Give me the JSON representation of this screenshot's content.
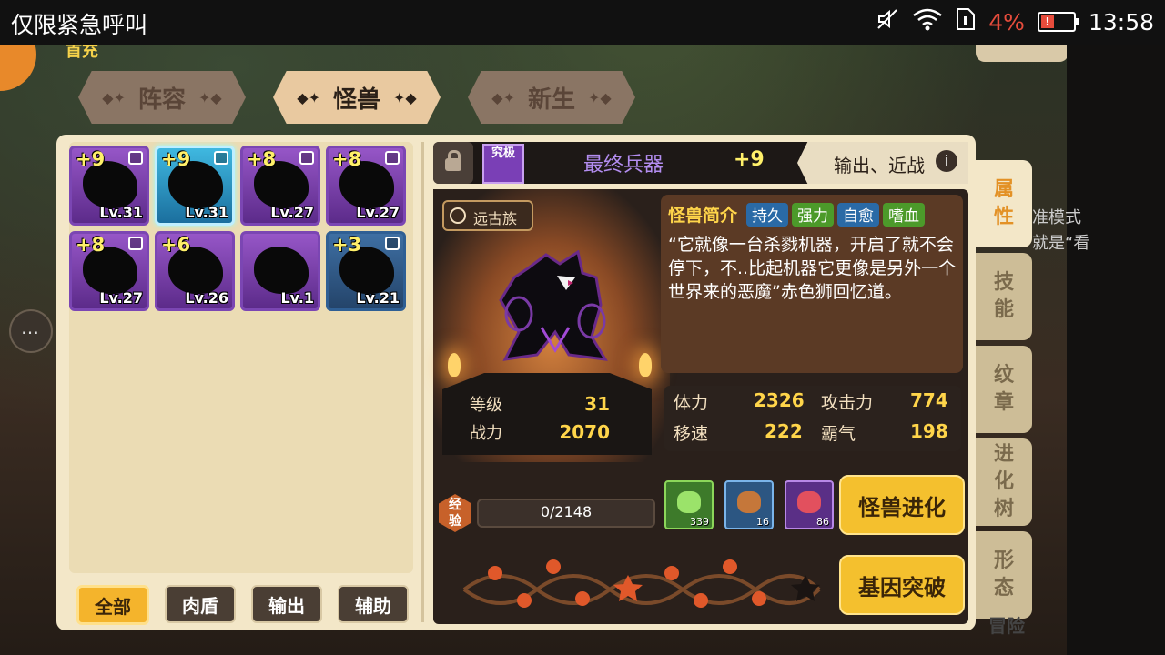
{
  "status_bar": {
    "title": "仅限紧急呼叫",
    "battery_percent": "4%",
    "battery_alert": "!",
    "time": "13:58"
  },
  "corner_tag": "首充",
  "tabs": [
    {
      "label": "阵容",
      "active": false
    },
    {
      "label": "怪兽",
      "active": true
    },
    {
      "label": "新生",
      "active": false
    }
  ],
  "monster_cards": [
    {
      "plus": "+9",
      "level": "Lv.31",
      "frame": "purple",
      "locked": true,
      "selected": false
    },
    {
      "plus": "+9",
      "level": "Lv.31",
      "frame": "blue-selected",
      "locked": true,
      "selected": true
    },
    {
      "plus": "+8",
      "level": "Lv.27",
      "frame": "purple",
      "locked": true,
      "selected": false
    },
    {
      "plus": "+8",
      "level": "Lv.27",
      "frame": "purple",
      "locked": true,
      "selected": false
    },
    {
      "plus": "+8",
      "level": "Lv.27",
      "frame": "purple",
      "locked": true,
      "selected": false
    },
    {
      "plus": "+6",
      "level": "Lv.26",
      "frame": "purple",
      "locked": false,
      "selected": false
    },
    {
      "plus": "",
      "level": "Lv.1",
      "frame": "purple",
      "locked": false,
      "selected": false
    },
    {
      "plus": "+3",
      "level": "Lv.21",
      "frame": "blue",
      "locked": true,
      "selected": false
    }
  ],
  "filters": [
    {
      "label": "全部",
      "active": true
    },
    {
      "label": "肉盾",
      "active": false
    },
    {
      "label": "输出",
      "active": false
    },
    {
      "label": "辅助",
      "active": false
    }
  ],
  "monster": {
    "rank": "究极",
    "name": "最终兵器",
    "plus": "+9",
    "roles": "输出、近战",
    "info_icon": "i",
    "tribe": "远古族",
    "level_label": "等级",
    "level": "31",
    "power_label": "战力",
    "power": "2070"
  },
  "intro": {
    "title": "怪兽简介",
    "tags": [
      "持久",
      "强力",
      "自愈",
      "嗜血"
    ],
    "text": "“它就像一台杀戮机器，开启了就不会停下，不..比起机器它更像是另外一个世界来的恶魔”赤色狮回忆道。"
  },
  "stats": [
    {
      "label": "体力",
      "value": "2326"
    },
    {
      "label": "攻击力",
      "value": "774"
    },
    {
      "label": "移速",
      "value": "222"
    },
    {
      "label": "霸气",
      "value": "198"
    }
  ],
  "exp": {
    "label": "经验",
    "value": "0/2148"
  },
  "items": [
    {
      "icon": "cabbage-icon",
      "count": "339",
      "frame": "green"
    },
    {
      "icon": "meat-leg-icon",
      "count": "16",
      "frame": "blue"
    },
    {
      "icon": "steak-icon",
      "count": "86",
      "frame": "purple"
    }
  ],
  "buttons": {
    "evolve": "怪兽进化",
    "gene": "基因突破"
  },
  "side_tabs": [
    {
      "label": "属性",
      "active": true
    },
    {
      "label": "技能",
      "active": false
    },
    {
      "label": "纹章",
      "active": false
    },
    {
      "label": "进化树",
      "active": false
    },
    {
      "label": "形态",
      "active": false
    }
  ],
  "background_text": {
    "right_snippet": "准模式就是“看",
    "bottom_label": "冒险"
  },
  "colors": {
    "accent_gold": "#f4c02e",
    "name_purple": "#b38df0",
    "value_yellow": "#ffd54a",
    "battery_red": "#e74c3c"
  }
}
